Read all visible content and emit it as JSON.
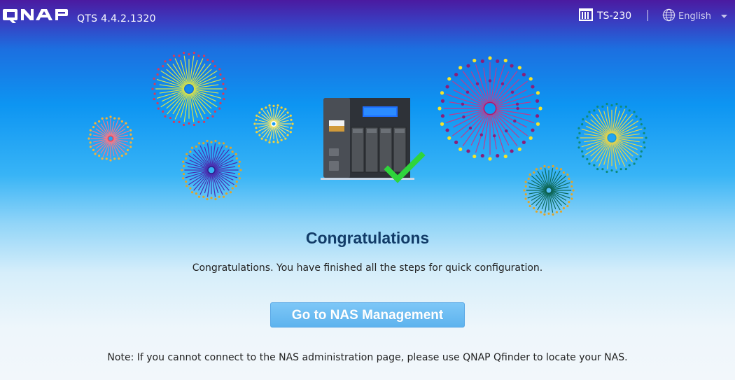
{
  "header": {
    "brand": "QNAP",
    "version": "QTS 4.4.2.1320",
    "model": "TS-230",
    "model_icon": "nas-icon",
    "language": "English",
    "language_icon": "globe-icon",
    "language_caret": "caret-down-icon"
  },
  "main": {
    "illustration_icon": "nas-device-checkmark-icon",
    "title": "Congratulations",
    "message": "Congratulations. You have finished all the steps for quick configuration.",
    "button_label": "Go to NAS Management",
    "note": "Note: If you cannot connect to the NAS administration page, please use QNAP Qfinder to locate your NAS."
  },
  "colors": {
    "title": "#123c68",
    "button": "#62b6ef",
    "checkmark": "#2fd53b",
    "header_top": "#4b1aa0",
    "sky": "#0d95f2"
  }
}
